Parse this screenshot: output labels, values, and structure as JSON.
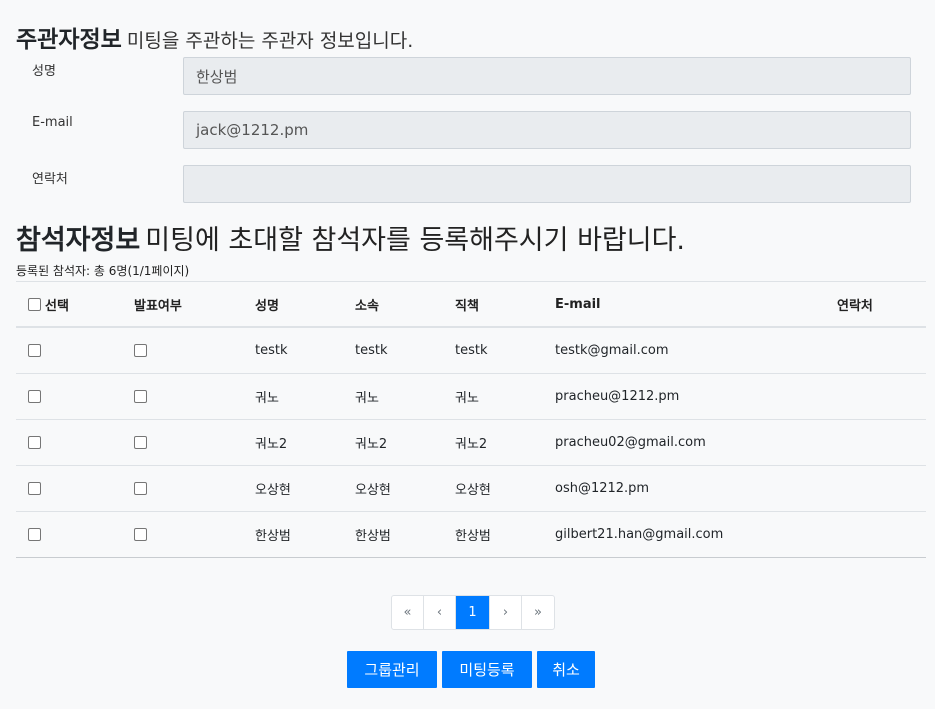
{
  "host_section": {
    "title": "주관자정보",
    "subtitle": "미팅을 주관하는 주관자 정보입니다."
  },
  "host_fields": [
    {
      "label": "성명",
      "value": "한상범"
    },
    {
      "label": "E-mail",
      "value": "jack@1212.pm"
    },
    {
      "label": "연락처",
      "value": ""
    }
  ],
  "participant_section": {
    "title": "참석자정보",
    "subtitle": "미팅에 초대할 참석자를 등록해주시기 바랍니다.",
    "count_text": "등록된 참석자: 총 6명(1/1페이지)"
  },
  "table": {
    "headers": [
      "선택",
      "발표여부",
      "성명",
      "소속",
      "직책",
      "E-mail",
      "연락처"
    ],
    "rows": [
      {
        "name": "testk",
        "org": "testk",
        "position": "testk",
        "email": "testk@gmail.com",
        "phone": ""
      },
      {
        "name": "궈노",
        "org": "궈노",
        "position": "궈노",
        "email": "pracheu@1212.pm",
        "phone": ""
      },
      {
        "name": "궈노2",
        "org": "궈노2",
        "position": "궈노2",
        "email": "pracheu02@gmail.com",
        "phone": ""
      },
      {
        "name": "오상현",
        "org": "오상현",
        "position": "오상현",
        "email": "osh@1212.pm",
        "phone": ""
      },
      {
        "name": "한상범",
        "org": "한상범",
        "position": "한상범",
        "email": "gilbert21.han@gmail.com",
        "phone": ""
      }
    ]
  },
  "pagination": {
    "first": "«",
    "prev": "‹",
    "current": "1",
    "next": "›",
    "last": "»"
  },
  "buttons": {
    "group": "그룹관리",
    "meeting": "미팅등록",
    "cancel": "취소"
  },
  "colors": {
    "accent": "#007bff",
    "input_bg": "#e9ecef",
    "page_bg": "#f8f9fa"
  }
}
